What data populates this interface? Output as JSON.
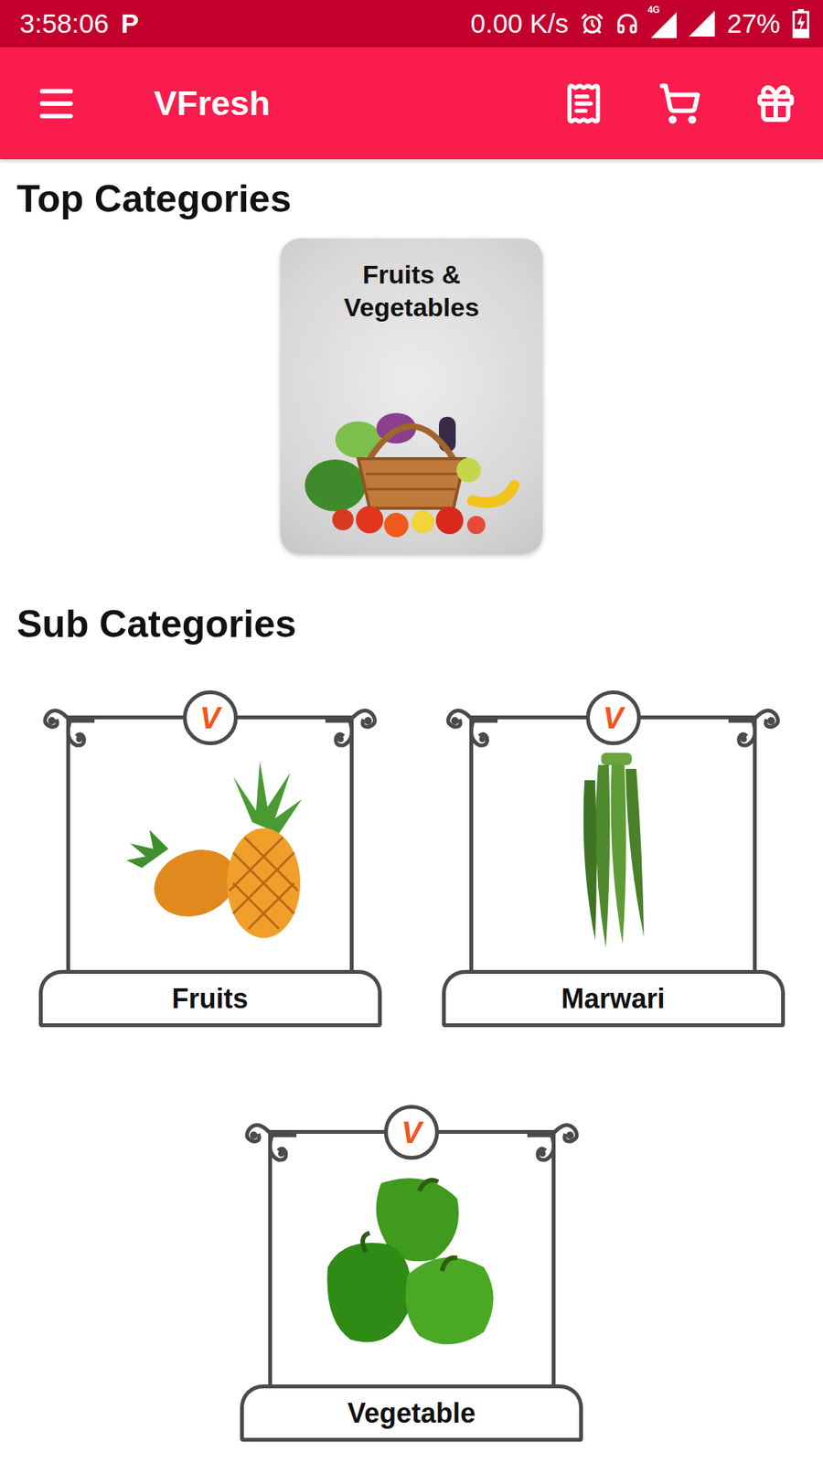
{
  "status_bar": {
    "time": "3:58:06",
    "app_icon": "P",
    "speed": "0.00 K/s",
    "network": "4G",
    "battery": "27%",
    "charging": true
  },
  "app_bar": {
    "title": "VFresh"
  },
  "top_categories": {
    "heading": "Top Categories",
    "items": [
      {
        "label": "Fruits & Vegetables"
      }
    ]
  },
  "sub_categories": {
    "heading": "Sub Categories",
    "badge": "V",
    "items": [
      {
        "label": "Fruits",
        "kind": "pineapple"
      },
      {
        "label": "Marwari",
        "kind": "okra"
      },
      {
        "label": "Vegetable",
        "kind": "pepper"
      }
    ]
  }
}
